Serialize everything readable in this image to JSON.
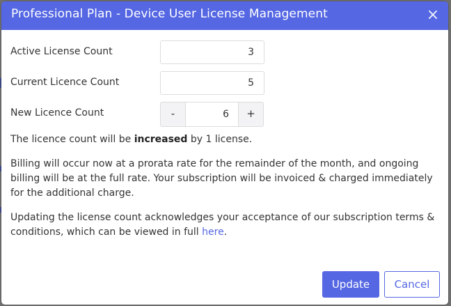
{
  "modal": {
    "title": "Professional Plan - Device User License Management",
    "close_symbol": "×"
  },
  "fields": {
    "active": {
      "label": "Active License Count",
      "value": "3"
    },
    "current": {
      "label": "Current Licence Count",
      "value": "5"
    },
    "new": {
      "label": "New Licence Count",
      "value": "6",
      "minus": "-",
      "plus": "+"
    }
  },
  "summary": {
    "prefix": "The licence count will be ",
    "emphasis": "increased",
    "suffix": " by 1 license."
  },
  "billing_text": "Billing will occur now at a prorata rate for the remainder of the month, and ongoing billing will be at the full rate. Your subscription will be invoiced & charged immediately for the additional charge.",
  "terms": {
    "text": "Updating the license count acknowledges your acceptance of our subscription terms & conditions, which can be viewed in full ",
    "link": "here",
    "end": "."
  },
  "buttons": {
    "update": "Update",
    "cancel": "Cancel"
  },
  "colors": {
    "accent": "#5567e3",
    "backdrop": "#6f6f6f"
  }
}
